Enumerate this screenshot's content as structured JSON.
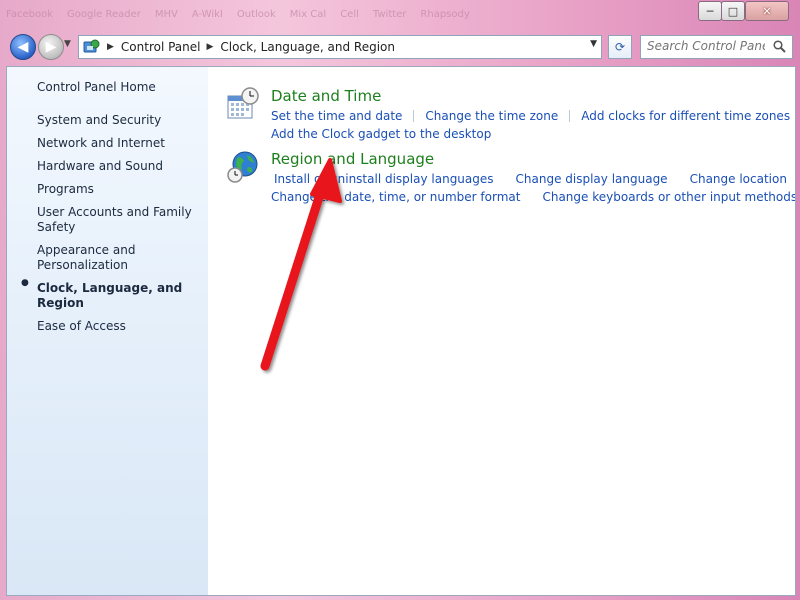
{
  "taskbar": {
    "items": [
      "Facebook",
      "Google Reader",
      "MHV",
      "A-WikI",
      "Outlook",
      "Mix Cal",
      "Cell",
      "Twitter",
      "Rhapsody"
    ]
  },
  "window": {
    "minimize": "─",
    "maximize": "□",
    "close": "✕"
  },
  "nav": {
    "back_glyph": "◀",
    "forward_glyph": "▶",
    "recent_glyph": "▼",
    "breadcrumb": [
      "Control Panel",
      "Clock, Language, and Region"
    ],
    "separator": "▶",
    "dropdown_glyph": "▼",
    "refresh_glyph": "⟳",
    "search_placeholder": "Search Control Panel"
  },
  "sidebar": {
    "home": "Control Panel Home",
    "items": [
      {
        "label": "System and Security"
      },
      {
        "label": "Network and Internet"
      },
      {
        "label": "Hardware and Sound"
      },
      {
        "label": "Programs"
      },
      {
        "label": "User Accounts and Family Safety"
      },
      {
        "label": "Appearance and Personalization"
      },
      {
        "label": "Clock, Language, and Region",
        "active": true
      },
      {
        "label": "Ease of Access"
      }
    ],
    "bullet": "●"
  },
  "categories": {
    "date_time": {
      "title": "Date and Time",
      "links": [
        "Set the time and date",
        "Change the time zone",
        "Add clocks for different time zones",
        "Add the Clock gadget to the desktop"
      ]
    },
    "region_language": {
      "title": "Region and Language",
      "links": [
        "Install or uninstall display languages",
        "Change display language",
        "Change location",
        "Change the date, time, or number format",
        "Change keyboards or other input methods"
      ]
    }
  },
  "colors": {
    "category_title": "#1e7f1e",
    "link": "#1a4fb5",
    "annotation_arrow": "#e8141a"
  }
}
